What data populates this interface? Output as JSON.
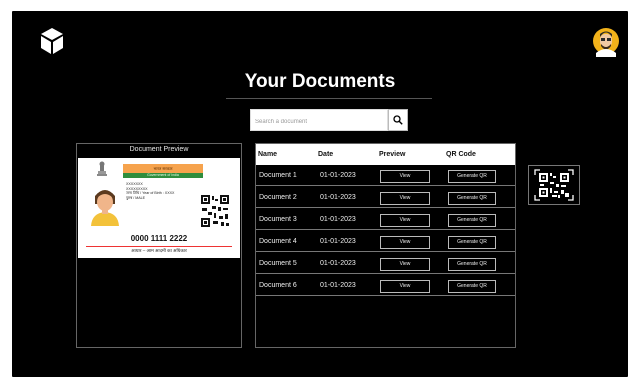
{
  "header": {
    "title": "Your Documents"
  },
  "search": {
    "placeholder": "Search a document"
  },
  "preview": {
    "title": "Document Preview",
    "card": {
      "ribbon_top": "भारत सरकार",
      "ribbon_bottom": "Government of India",
      "name_line1": "XXXXXXX",
      "name_line2": "XXXXXXXXX",
      "dob_line": "जन्म तिथि / Year of Birth : XXXX",
      "gender_line": "पुरुष / MALE",
      "aadhaar_number": "0000 1111 2222",
      "tagline": "आधार – आम आदमी का अधिकार"
    }
  },
  "table": {
    "headers": [
      "Name",
      "Date",
      "Preview",
      "QR Code"
    ],
    "rows": [
      {
        "name": "Document 1",
        "date": "01-01-2023",
        "view": "View",
        "qr": "Generate QR"
      },
      {
        "name": "Document 2",
        "date": "01-01-2023",
        "view": "View",
        "qr": "Generate QR"
      },
      {
        "name": "Document 3",
        "date": "01-01-2023",
        "view": "View",
        "qr": "Generate QR"
      },
      {
        "name": "Document 4",
        "date": "01-01-2023",
        "view": "View",
        "qr": "Generate QR"
      },
      {
        "name": "Document 5",
        "date": "01-01-2023",
        "view": "View",
        "qr": "Generate QR"
      },
      {
        "name": "Document 6",
        "date": "01-01-2023",
        "view": "View",
        "qr": "Generate QR"
      }
    ]
  },
  "icons": {
    "logo": "cube-logo-icon",
    "avatar": "user-avatar-icon",
    "search": "search-icon",
    "qr": "qr-code-icon"
  },
  "colors": {
    "background": "#000000",
    "text": "#ffffff",
    "accent_orange": "#f6a34d",
    "accent_green": "#2f8d3d"
  }
}
